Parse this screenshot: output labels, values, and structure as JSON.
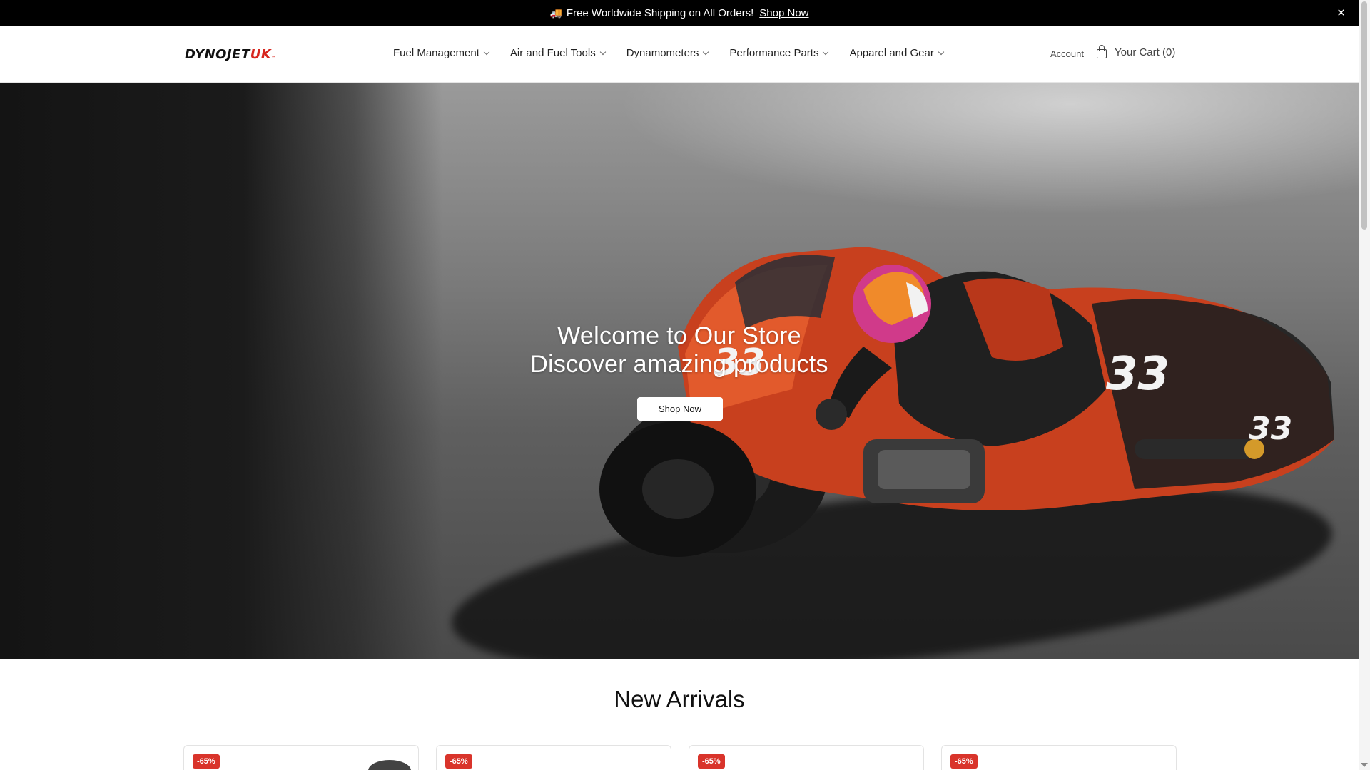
{
  "announcement": {
    "icon": "truck-icon",
    "text": "Free Worldwide Shipping on All Orders!",
    "link_label": "Shop Now",
    "close_glyph": "✕"
  },
  "header": {
    "logo": {
      "part1": "DYNOJET",
      "part2": "UK",
      "mark": "™"
    },
    "nav": [
      {
        "label": "Fuel Management"
      },
      {
        "label": "Air and Fuel Tools"
      },
      {
        "label": "Dynamometers"
      },
      {
        "label": "Performance Parts"
      },
      {
        "label": "Apparel and Gear"
      }
    ],
    "account_label": "Account",
    "cart_label": "Your Cart (0)"
  },
  "hero": {
    "line1": "Welcome to Our Store",
    "line2": "Discover amazing products",
    "button_label": "Shop Now"
  },
  "new_arrivals": {
    "title": "New Arrivals",
    "cards": [
      {
        "badge": "-65%"
      },
      {
        "badge": "-65%"
      },
      {
        "badge": "-65%"
      },
      {
        "badge": "-65%"
      }
    ]
  },
  "colors": {
    "accent_red": "#d7261e",
    "badge_red": "#d9342b",
    "bar_black": "#000000"
  }
}
